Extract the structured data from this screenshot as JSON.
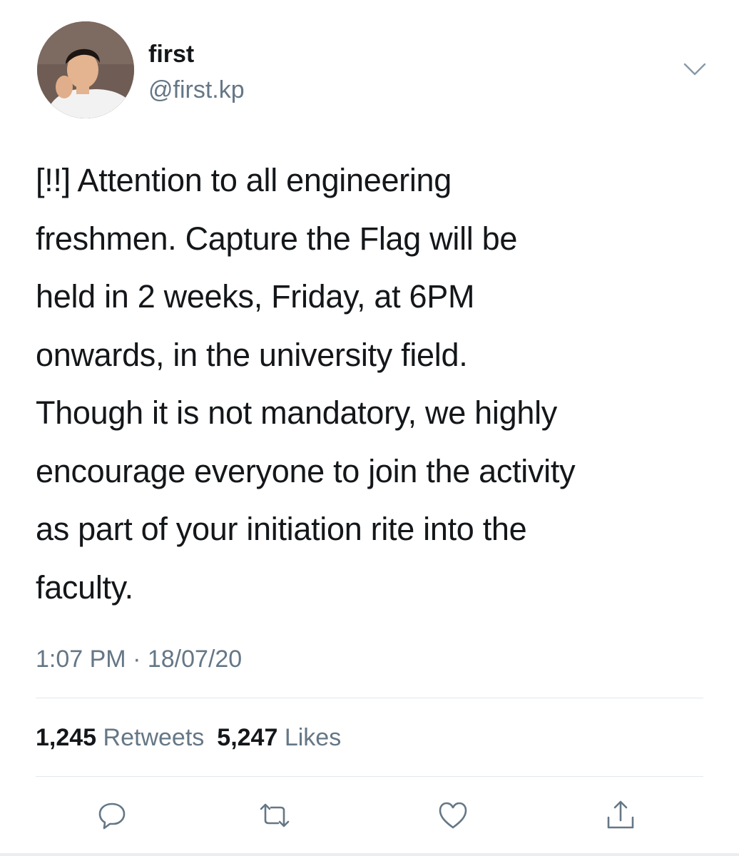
{
  "author": {
    "display_name": "first",
    "handle": "@first.kp",
    "avatar": "profile-photo"
  },
  "tweet": {
    "text": "[!!] Attention to all engineering\nfreshmen. Capture the Flag will be\nheld in 2 weeks, Friday, at 6PM\nonwards, in the university field.\nThough it is not mandatory, we highly\nencourage everyone to join the activity\nas part of your initiation rite into the\nfaculty.",
    "time": "1:07 PM",
    "separator": "·",
    "date": "18/07/20"
  },
  "stats": {
    "retweets_count": "1,245",
    "retweets_label": "Retweets",
    "likes_count": "5,247",
    "likes_label": "Likes"
  },
  "actions": [
    {
      "name": "reply",
      "icon": "speech-bubble-icon"
    },
    {
      "name": "retweet",
      "icon": "retweet-arrows-icon"
    },
    {
      "name": "like",
      "icon": "heart-icon"
    },
    {
      "name": "share",
      "icon": "share-upload-icon"
    }
  ],
  "menu_icon": "chevron-down-icon",
  "colors": {
    "text_primary": "#14171a",
    "text_secondary": "#657786",
    "divider": "#e1e8ed",
    "icon": "#657786",
    "background": "#ffffff"
  }
}
